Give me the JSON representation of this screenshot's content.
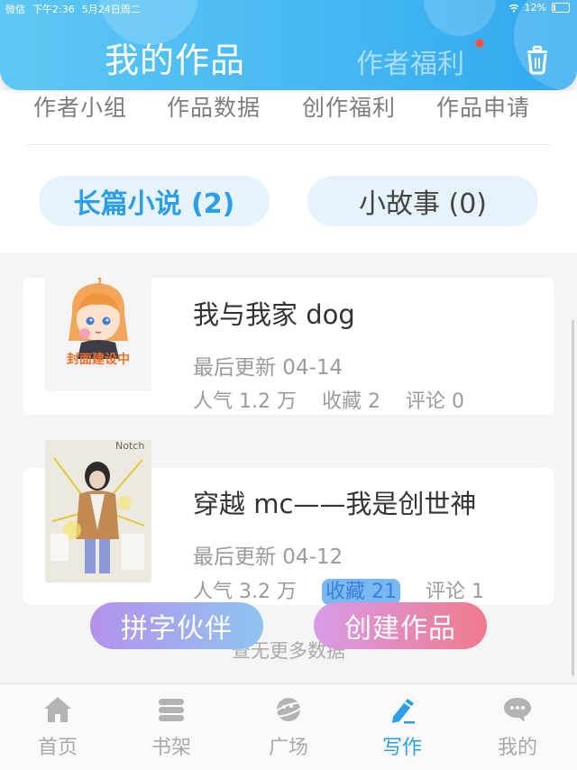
{
  "status_bar": {
    "app": "微信",
    "time": "下午2:36",
    "date": "5月24日周二",
    "battery": "12%",
    "battery_level": 0.12
  },
  "header": {
    "title": "我的作品",
    "welfare_label": "作者福利",
    "trash_icon": "trash-icon"
  },
  "subnav": {
    "items": [
      {
        "label": "作者小组"
      },
      {
        "label": "作品数据"
      },
      {
        "label": "创作福利"
      },
      {
        "label": "作品申请"
      }
    ]
  },
  "tabs": {
    "novels": "长篇小说 (2)",
    "stories": "小故事 (0)"
  },
  "books": [
    {
      "title": "我与我家 dog",
      "updated": "最后更新 04-14",
      "popularity": "人气 1.2 万",
      "favorites": "收藏 2",
      "comments": "评论 0",
      "cover_text": "封面建设中"
    },
    {
      "title": "穿越 mc——我是创世神",
      "updated": "最后更新 04-12",
      "popularity": "人气 3.2 万",
      "favorites": "收藏 21",
      "comments": "评论 1",
      "cover_text": "Notch"
    }
  ],
  "actions": {
    "partner": "拼字伙伴",
    "create": "创建作品",
    "load_more": "查无更多数据"
  },
  "tabbar": {
    "items": [
      {
        "label": "首页",
        "icon": "home-icon"
      },
      {
        "label": "书架",
        "icon": "bookshelf-icon"
      },
      {
        "label": "广场",
        "icon": "planet-icon"
      },
      {
        "label": "写作",
        "icon": "pen-icon"
      },
      {
        "label": "我的",
        "icon": "chat-icon"
      }
    ],
    "active": "写作"
  },
  "colors": {
    "accent": "#2b9ee9",
    "header_gradient_start": "#5ec8f5",
    "header_gradient_end": "#31a9ef",
    "badge_dot": "#e8594a"
  }
}
